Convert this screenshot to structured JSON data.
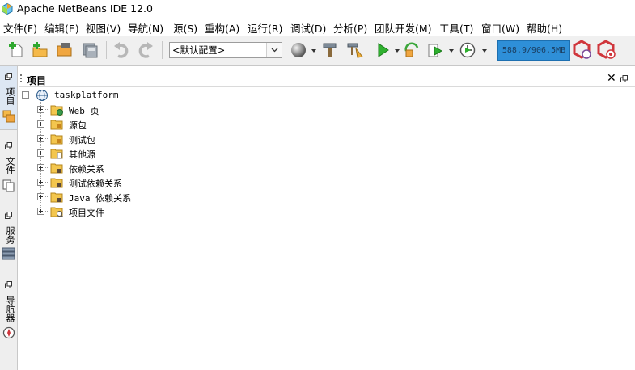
{
  "window": {
    "title": "Apache NetBeans IDE 12.0"
  },
  "menu": [
    {
      "label": "文件(F)"
    },
    {
      "label": "编辑(E)"
    },
    {
      "label": "视图(V)"
    },
    {
      "label": "导航(N)"
    },
    {
      "label": "源(S)"
    },
    {
      "label": "重构(A)"
    },
    {
      "label": "运行(R)"
    },
    {
      "label": "调试(D)"
    },
    {
      "label": "分析(P)"
    },
    {
      "label": "团队开发(M)"
    },
    {
      "label": "工具(T)"
    },
    {
      "label": "窗口(W)"
    },
    {
      "label": "帮助(H)"
    }
  ],
  "toolbar": {
    "config_value": "<默认配置>",
    "memory_label": "588.9/906.5MB"
  },
  "sidebar": {
    "tabs": [
      {
        "label": "项目"
      },
      {
        "label": "文件"
      },
      {
        "label": "服务"
      },
      {
        "label": "导航器"
      }
    ]
  },
  "panel": {
    "title": "项目"
  },
  "tree": {
    "root": "taskplatform",
    "children": [
      {
        "label": "Web 页"
      },
      {
        "label": "源包"
      },
      {
        "label": "测试包"
      },
      {
        "label": "其他源"
      },
      {
        "label": "依赖关系"
      },
      {
        "label": "测试依赖关系"
      },
      {
        "label": "Java 依赖关系"
      },
      {
        "label": "项目文件"
      }
    ]
  },
  "colors": {
    "accent": "#2e8fd8",
    "folder": "#f3c64e",
    "run": "#27a527"
  }
}
